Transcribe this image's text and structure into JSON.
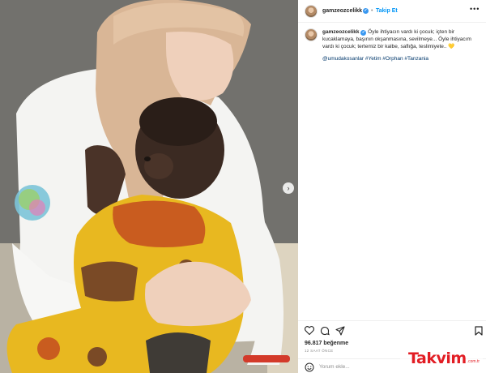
{
  "post": {
    "username": "gamzeozcelikk",
    "follow_label": "Takip Et",
    "separator": "•",
    "more_icon": "ellipsis-icon",
    "verified_icon": "verified-badge-icon"
  },
  "caption": {
    "username": "gamzeozcelikk",
    "line1": "Öyle ihtiyacın vardı ki çocuk; içten bir",
    "line2": "kucaklamaya, başının okşanmasına, sevilmeye... Öyle ihtiyacım",
    "line3": "vardı ki çocuk; tertemiz bir kalbe, saflığa, teslimiyete..",
    "emoji": "💛",
    "tags": "@umudakosanlar #Yetim #Orphan #Tanzania"
  },
  "actions": {
    "like_icon": "heart-icon",
    "comment_icon": "comment-icon",
    "share_icon": "share-icon",
    "save_icon": "bookmark-icon",
    "likes_text": "96.817 beğenme",
    "time_text": "12 SAAT ÖNCE"
  },
  "comment": {
    "placeholder": "Yorum ekle...",
    "emoji_icon": "smiley-icon"
  },
  "carousel": {
    "next_icon": "chevron-right-icon"
  },
  "watermark": {
    "text": "Takvim",
    "suffix": ".com.tr"
  },
  "colors": {
    "accent": "#0095f6",
    "verified": "#3897f0",
    "watermark": "#e21d24",
    "hijab": "#d9b696",
    "fabric_yellow": "#e8b820"
  }
}
